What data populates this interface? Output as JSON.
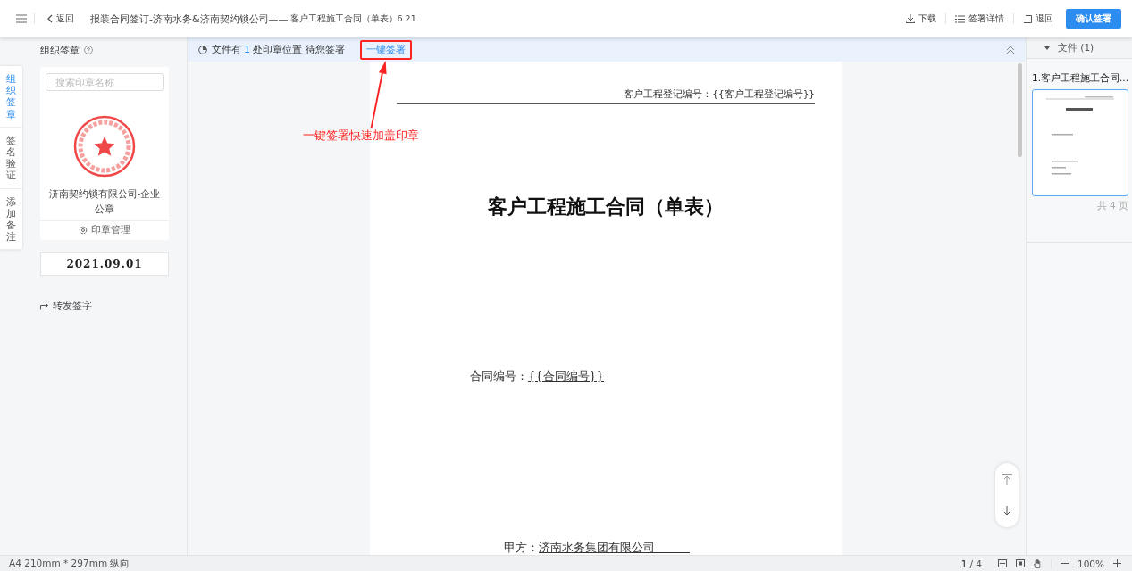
{
  "header": {
    "back": "返回",
    "title": "报装合同签订-济南水务&济南契约锁公司——",
    "subtitle": "客户工程施工合同（单表）6.21",
    "actions": [
      {
        "kind": "download",
        "label": "下载"
      },
      {
        "kind": "details",
        "label": "签署详情"
      },
      {
        "kind": "return",
        "label": "退回"
      }
    ],
    "confirm": "确认签署"
  },
  "side_tabs": [
    {
      "label": "组织签章",
      "selected": true
    },
    {
      "label": "签名验证",
      "selected": false
    },
    {
      "label": "添加备注",
      "selected": false
    }
  ],
  "seal_panel": {
    "title": "组织签章",
    "search": {
      "placeholder": "搜索印章名称"
    },
    "seal_name": "济南契约锁有限公司-企业公章",
    "manage": "印章管理",
    "date": "2021.09.01",
    "forward": "转发签字"
  },
  "notice": {
    "prefix": "文件有",
    "count": "1",
    "suffix": "处印章位置 待您签署",
    "action": "一键签署"
  },
  "annotation": "一键签署快速加盖印章",
  "document": {
    "header_field": "客户工程登记编号：{{客户工程登记编号}}",
    "title": "客户工程施工合同（单表）",
    "contract_no_label": "合同编号：",
    "contract_no": "{{合同编号}}",
    "party_label": "甲方：",
    "party": "济南水务集团有限公司"
  },
  "files": {
    "header": "文件 (1)",
    "items": [
      {
        "name": "1.客户工程施工合同...",
        "selected": true,
        "pages": "共 4 页"
      }
    ]
  },
  "status_bar": {
    "paper": "A4 210mm * 297mm 纵向",
    "page": "1",
    "total": "/ 4",
    "zoom": "100%"
  }
}
